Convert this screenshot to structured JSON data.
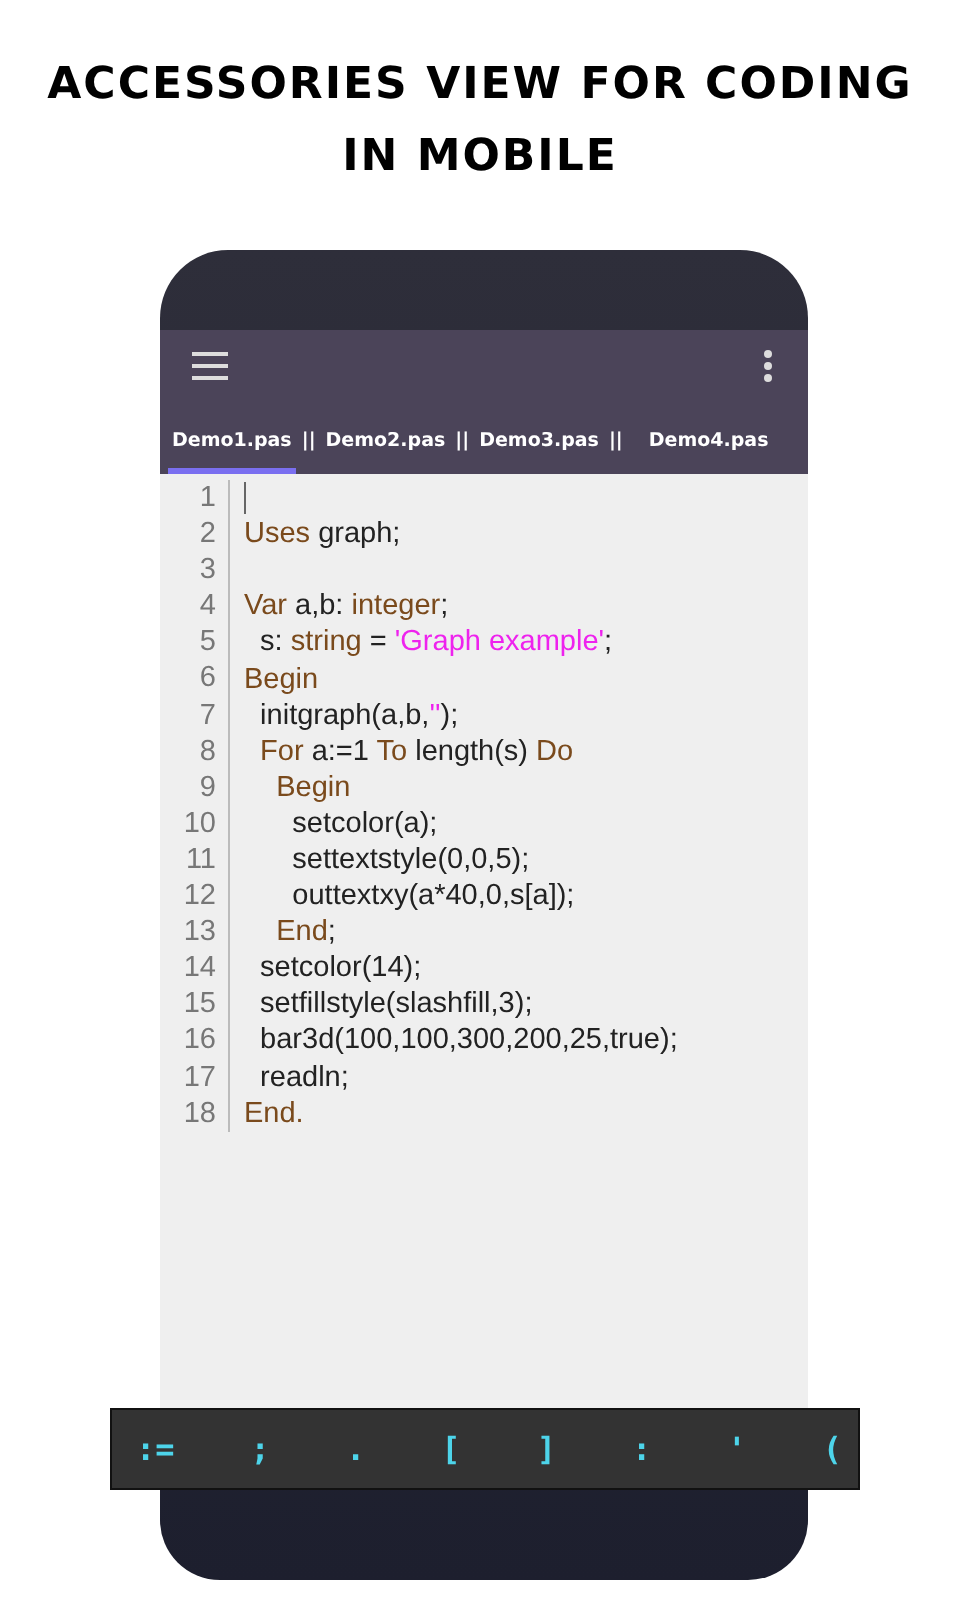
{
  "headline": [
    "ACCESSORIES VIEW FOR CODING",
    "IN MOBILE"
  ],
  "tabs": [
    {
      "label": "Demo1.pas",
      "selected": true,
      "separator": "||"
    },
    {
      "label": "Demo2.pas",
      "selected": false,
      "separator": "||"
    },
    {
      "label": "Demo3.pas",
      "selected": false,
      "separator": "||"
    },
    {
      "label": "Demo4.pas",
      "selected": false
    }
  ],
  "editor": {
    "lines": [
      {
        "number": "1",
        "cursor": true
      },
      {
        "number": "2",
        "tokens": [
          {
            "kind": "keyword",
            "text": "Uses"
          },
          {
            "kind": "plain",
            "text": " graph;"
          }
        ]
      },
      {
        "number": "3"
      },
      {
        "number": "4",
        "tokens": [
          {
            "kind": "keyword",
            "text": "Var"
          },
          {
            "kind": "plain",
            "text": " a,b: "
          },
          {
            "kind": "keyword",
            "text": "integer"
          },
          {
            "kind": "plain",
            "text": ";"
          }
        ]
      },
      {
        "number": "5",
        "tokens": [
          {
            "kind": "plain",
            "text": "  s: "
          },
          {
            "kind": "keyword",
            "text": "string"
          },
          {
            "kind": "plain",
            "text": " = "
          },
          {
            "kind": "string",
            "text": "'Graph example'"
          },
          {
            "kind": "plain",
            "text": ";"
          }
        ]
      },
      {
        "number": "6",
        "tokens": [
          {
            "kind": "keyword",
            "text": "Begin"
          }
        ]
      },
      {
        "number": "7",
        "tokens": [
          {
            "kind": "plain",
            "text": "  initgraph(a,b,"
          },
          {
            "kind": "string",
            "text": "''"
          },
          {
            "kind": "plain",
            "text": ");"
          }
        ]
      },
      {
        "number": "8",
        "tokens": [
          {
            "kind": "keyword",
            "text": "  For"
          },
          {
            "kind": "plain",
            "text": " a:=1 "
          },
          {
            "kind": "keyword",
            "text": "To"
          },
          {
            "kind": "plain",
            "text": " length(s) "
          },
          {
            "kind": "keyword",
            "text": "Do"
          }
        ]
      },
      {
        "number": "9",
        "tokens": [
          {
            "kind": "keyword",
            "text": "    Begin"
          }
        ]
      },
      {
        "number": "10",
        "tokens": [
          {
            "kind": "plain",
            "text": "      setcolor(a);"
          }
        ]
      },
      {
        "number": "11",
        "tokens": [
          {
            "kind": "plain",
            "text": "      settextstyle(0,0,5);"
          }
        ]
      },
      {
        "number": "12",
        "tokens": [
          {
            "kind": "plain",
            "text": "      outtextxy(a*40,0,s[a]);"
          }
        ]
      },
      {
        "number": "13",
        "tokens": [
          {
            "kind": "keyword",
            "text": "    End"
          },
          {
            "kind": "plain",
            "text": ";"
          }
        ]
      },
      {
        "number": "14",
        "tokens": [
          {
            "kind": "plain",
            "text": "  setcolor(14);"
          }
        ]
      },
      {
        "number": "15",
        "tokens": [
          {
            "kind": "plain",
            "text": "  setfillstyle(slashfill,3);"
          }
        ]
      },
      {
        "number": "16",
        "tokens": [
          {
            "kind": "plain",
            "text": "  bar3d(100,100,300,200,25,true);"
          }
        ]
      },
      {
        "number": "17",
        "tokens": [
          {
            "kind": "plain",
            "text": "  readln;"
          }
        ]
      },
      {
        "number": "18",
        "tokens": [
          {
            "kind": "keyword",
            "text": "End."
          }
        ]
      }
    ]
  },
  "accessory_keys": [
    ":=",
    ";",
    ".",
    "[",
    "]",
    ":",
    "'",
    "("
  ]
}
